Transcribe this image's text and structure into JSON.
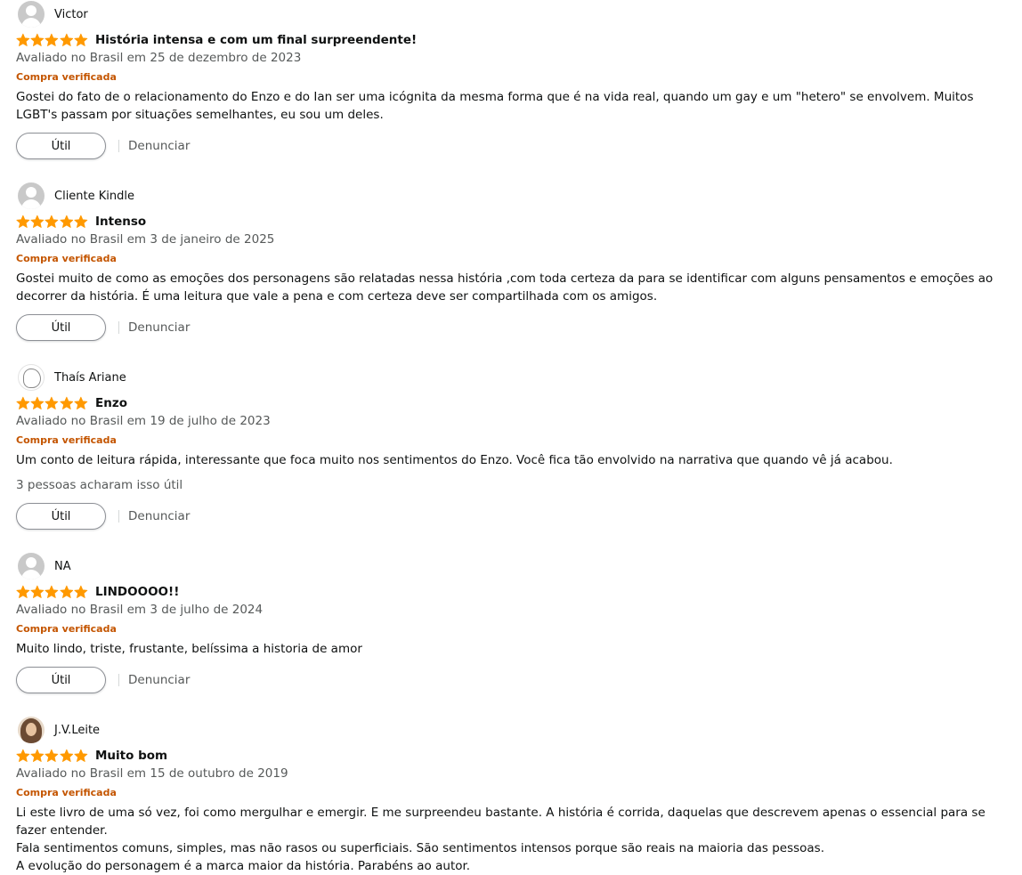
{
  "colors": {
    "star": "#ff9900",
    "verified": "#c45500",
    "meta": "#565959",
    "text": "#0f1111"
  },
  "reviews": [
    {
      "name": "Victor",
      "avatar": "default-avatar-icon",
      "rating": 5,
      "title": "História intensa e com um final surpreendente!",
      "date": "Avaliado no Brasil em 25 de dezembro de 2023",
      "verified": "Compra verificada",
      "body": [
        "Gostei do fato de o relacionamento do Enzo e do Ian ser uma icógnita da mesma forma que é na vida real, quando um gay e um \"hetero\" se envolvem. Muitos LGBT's passam por situações semelhantes, eu sou um deles."
      ],
      "helpful": "",
      "util_label": "Útil",
      "report_label": "Denunciar"
    },
    {
      "name": "Cliente Kindle",
      "avatar": "default-avatar-icon",
      "rating": 5,
      "title": "Intenso",
      "date": "Avaliado no Brasil em 3 de janeiro de 2025",
      "verified": "Compra verificada",
      "body": [
        "Gostei muito de como as emoções dos personagens são relatadas nessa história ,com toda certeza da para se identificar com alguns pensamentos e emoções ao decorrer da história. É uma leitura que vale a pena e com certeza deve ser compartilhada com os amigos."
      ],
      "helpful": "",
      "util_label": "Útil",
      "report_label": "Denunciar"
    },
    {
      "name": "Thaís Ariane",
      "avatar": "sketch-avatar-icon",
      "rating": 5,
      "title": "Enzo",
      "date": "Avaliado no Brasil em 19 de julho de 2023",
      "verified": "Compra verificada",
      "body": [
        "Um conto de leitura rápida, interessante que foca muito nos sentimentos do Enzo. Você fica tão envolvido na narrativa que quando vê já acabou."
      ],
      "helpful": "3 pessoas acharam isso útil",
      "util_label": "Útil",
      "report_label": "Denunciar"
    },
    {
      "name": "NA",
      "avatar": "default-avatar-icon",
      "rating": 5,
      "title": "LINDOOOO!!",
      "date": "Avaliado no Brasil em 3 de julho de 2024",
      "verified": "Compra verificada",
      "body": [
        "Muito lindo, triste, frustante, belíssima a historia de amor"
      ],
      "helpful": "",
      "util_label": "Útil",
      "report_label": "Denunciar"
    },
    {
      "name": "J.V.Leite",
      "avatar": "photo-avatar-icon",
      "rating": 5,
      "title": "Muito bom",
      "date": "Avaliado no Brasil em 15 de outubro de 2019",
      "verified": "Compra verificada",
      "body": [
        "Li este livro de uma só vez, foi como mergulhar e emergir. E me surpreendeu bastante. A história é corrida, daquelas que descrevem apenas o essencial para se fazer entender.",
        "Fala sentimentos comuns, simples, mas não rasos ou superficiais. São sentimentos intensos porque são reais na maioria das pessoas.",
        "A evolução do personagem é a marca maior da história. Parabéns ao autor."
      ],
      "helpful": "",
      "util_label": "Útil",
      "report_label": "Denunciar"
    }
  ]
}
